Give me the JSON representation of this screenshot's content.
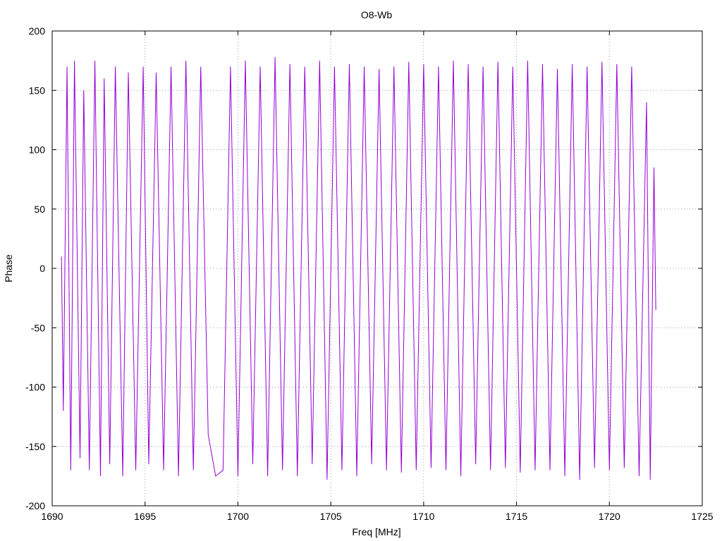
{
  "chart_data": {
    "type": "line",
    "title": "O8-Wb",
    "xlabel": "Freq [MHz]",
    "ylabel": "Phase",
    "xlim": [
      1690,
      1725
    ],
    "ylim": [
      -200,
      200
    ],
    "xticks": [
      1690,
      1695,
      1700,
      1705,
      1710,
      1715,
      1720,
      1725
    ],
    "yticks": [
      -200,
      -150,
      -100,
      -50,
      0,
      50,
      100,
      150,
      200
    ],
    "grid": true,
    "legend": "none",
    "series": [
      {
        "color": "#9400d3",
        "x_range": [
          1690.5,
          1722.5
        ],
        "y_range": [
          -180,
          180
        ],
        "description_values": {
          "x": [
            1690.5,
            1690.6,
            1690.8,
            1691.0,
            1691.2,
            1691.5,
            1691.7,
            1692.0,
            1692.3,
            1692.6,
            1692.8,
            1693.1,
            1693.4,
            1693.8,
            1694.1,
            1694.5,
            1694.9,
            1695.2,
            1695.6,
            1696.0,
            1696.4,
            1696.8,
            1697.2,
            1697.6,
            1698.0,
            1698.4,
            1698.8,
            1699.2,
            1699.6,
            1700.0,
            1700.4,
            1700.8,
            1701.2,
            1701.6,
            1702.0,
            1702.4,
            1702.8,
            1703.2,
            1703.6,
            1704.0,
            1704.4,
            1704.8,
            1705.2,
            1705.6,
            1706.0,
            1706.4,
            1706.8,
            1707.2,
            1707.6,
            1708.0,
            1708.4,
            1708.8,
            1709.2,
            1709.6,
            1710.0,
            1710.4,
            1710.8,
            1711.2,
            1711.6,
            1712.0,
            1712.4,
            1712.8,
            1713.2,
            1713.6,
            1714.0,
            1714.4,
            1714.8,
            1715.2,
            1715.6,
            1716.0,
            1716.4,
            1716.8,
            1717.2,
            1717.6,
            1718.0,
            1718.4,
            1718.8,
            1719.2,
            1719.6,
            1720.0,
            1720.4,
            1720.8,
            1721.2,
            1721.6,
            1722.0,
            1722.2,
            1722.4,
            1722.5
          ],
          "y": [
            10,
            -120,
            170,
            -170,
            175,
            -160,
            150,
            -170,
            175,
            -175,
            160,
            -165,
            170,
            -175,
            165,
            -170,
            170,
            -165,
            165,
            -170,
            170,
            -175,
            175,
            -170,
            170,
            -140,
            -175,
            -170,
            170,
            -175,
            175,
            -165,
            170,
            -175,
            178,
            -170,
            172,
            -175,
            170,
            -165,
            175,
            -178,
            170,
            -170,
            172,
            -175,
            170,
            -165,
            168,
            -170,
            170,
            -172,
            174,
            -170,
            172,
            -168,
            170,
            -170,
            175,
            -175,
            172,
            -165,
            170,
            -170,
            174,
            -168,
            170,
            -172,
            175,
            -170,
            172,
            -170,
            168,
            -175,
            172,
            -178,
            170,
            -168,
            174,
            -170,
            172,
            -168,
            170,
            -175,
            140,
            -178,
            85,
            -35
          ]
        }
      }
    ]
  }
}
